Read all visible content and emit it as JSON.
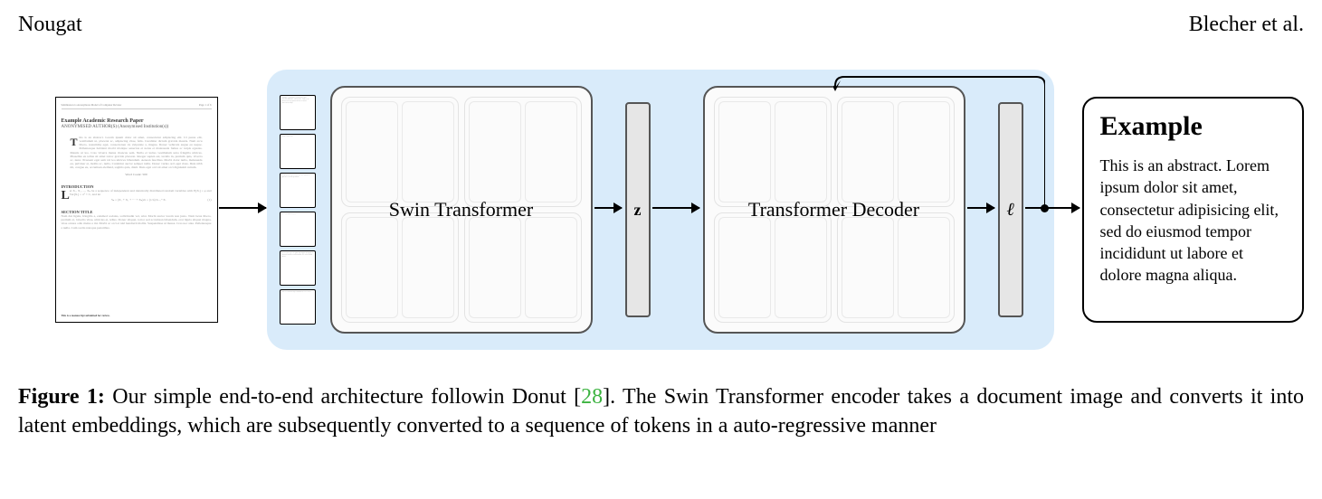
{
  "header": {
    "left": "Nougat",
    "right": "Blecher et al."
  },
  "diagram": {
    "encoder_label": "Swin Transformer",
    "latent_z": "z",
    "decoder_label": "Transformer Decoder",
    "latent_l": "ℓ",
    "output": {
      "title": "Example",
      "body": "This is an abstract. Lorem ipsum dolor sit amet, consectetur adipisicing elit, sed do eiusmod tempor incididunt ut labore et dolore magna aliqua."
    },
    "input_doc": {
      "running_header_left": "Submission to Anonymous Model of Computer Review",
      "running_header_right": "Page 1 of 6",
      "title": "Example Academic Research Paper",
      "author": "ANONYMISED AUTHOR(S)   (Anonymised Institution(s))",
      "abstract_dropcap": "T",
      "abstract": "his is an abstract. Lorem ipsum dolor sit amet, consectetur adipiscing elit. Ut purus elit, vestibulum ut, placerat ac, adipiscing vitae, felis. Curabitur dictum gravida mauris. Nam arcu libero, nonummy eget, consectetuer id, vulputate a, magna. Donec vehicula augue eu neque. Pellentesque habitant morbi tristique senectus et netus et malesuada fames ac turpis egestas. Mauris ut leo. Cras viverra metus rhoncus sem. Nulla et lectus vestibulum urna fringilla ultrices. Phasellus eu tellus sit amet tortor gravida placerat. Integer sapien est, iaculis in, pretium quis, viverra ac, nunc. Praesent eget sem vel leo ultrices bibendum. Aenean faucibus. Morbi dolor nulla, malesuada eu, pulvinar at, mollis ac, nulla. Curabitur auctor semper nulla. Donec varius orci eget risus. Duis nibh mi, congue eu, accumsan eleifend, sagittis quis, diam. Duis eget orci sit amet orci dignissim rutrum.",
      "word_count": "Word Count:   500",
      "section1": "INTRODUCTION",
      "intro_dropcap": "L",
      "intro": "et X₁, X₂, ..., Xₙ be a sequence of independent and identically distributed random variables with E[Xᵢ] = μ and Var[Xᵢ] = σ² < ∞, and let",
      "equation": "Sₙ = (X₁ + X₂ + ⋯ + Xₙ)/n = (1/n) Σᵢ₌₁ⁿ Xᵢ",
      "eq_num": "(1)",
      "section2": "SECTION TITLE",
      "body2": "Nam dui ligula, fringilla a, euismod sodales, sollicitudin vel, wisi. Morbi auctor lorem non justo. Nam lacus libero, pretium at, lobortis vitae, ultricies et, tellus. Donec aliquet, tortor sed accumsan bibendum, erat ligula aliquet magna, vitae ornare odio metus a mi. Morbi ac orci et nisl hendrerit mollis. Suspendisse ut massa. Cras nec ante. Pellentesque a nulla. Cum sociis natoque penatibus.",
      "footer": "This is a manuscript submitted for review."
    }
  },
  "caption": {
    "label": "Figure 1:",
    "text_1": " Our simple end-to-end architecture followin Donut [",
    "cite": "28",
    "text_2": "]. The Swin Transformer encoder takes a document image and converts it into latent embeddings, which are subsequently converted to a sequence of tokens in a auto-regressive manner"
  }
}
